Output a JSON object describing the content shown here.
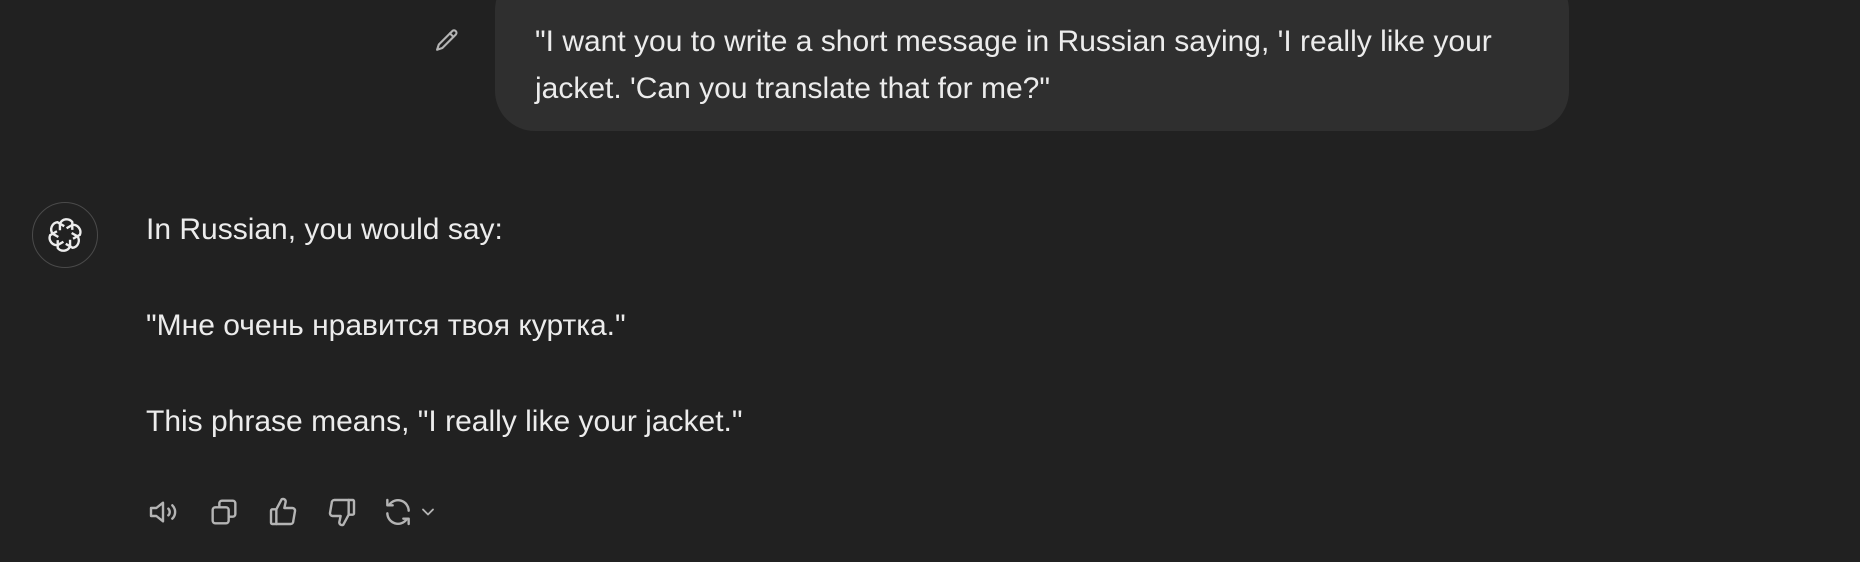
{
  "user_message": {
    "text": "\"I want you to write a short message in Russian saying, 'I really like your jacket. 'Can you translate that for me?\""
  },
  "assistant_message": {
    "paragraphs": [
      "In Russian, you would say:",
      "\"Мне очень нравится твоя куртка.\"",
      "This phrase means, \"I really like your jacket.\""
    ]
  },
  "icons": {
    "edit": "pencil-icon",
    "avatar": "openai-logo-icon",
    "read_aloud": "speaker-icon",
    "copy": "copy-icon",
    "thumbs_up": "thumbs-up-icon",
    "thumbs_down": "thumbs-down-icon",
    "regenerate": "refresh-icon",
    "model_menu": "chevron-down-icon"
  },
  "colors": {
    "background": "#212121",
    "user_bubble": "#2f2f2f",
    "text": "#ececec",
    "icon": "#b4b4b4"
  }
}
